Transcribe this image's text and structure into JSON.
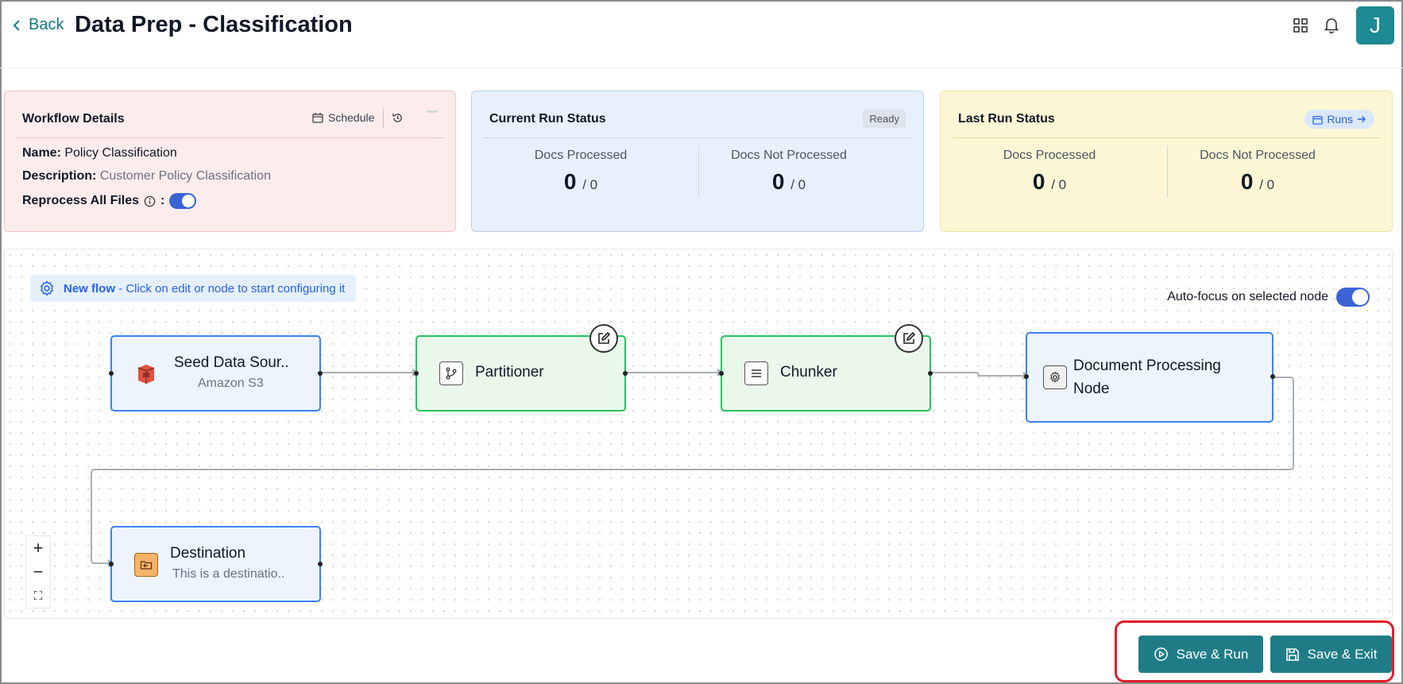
{
  "header": {
    "back_label": "Back",
    "title": "Data Prep - Classification",
    "avatar_initial": "J"
  },
  "workflow_card": {
    "title": "Workflow Details",
    "schedule_label": "Schedule",
    "name_label": "Name:",
    "name_value": "Policy Classification",
    "description_label": "Description:",
    "description_value": "Customer Policy Classification",
    "reprocess_label": "Reprocess All Files",
    "reprocess_colon": ":",
    "reprocess_enabled": true
  },
  "current_run": {
    "title": "Current Run Status",
    "badge": "Ready",
    "processed_label": "Docs Processed",
    "processed_value": "0",
    "processed_total": "/ 0",
    "not_processed_label": "Docs Not Processed",
    "not_processed_value": "0",
    "not_processed_total": "/ 0"
  },
  "last_run": {
    "title": "Last Run Status",
    "runs_label": "Runs",
    "processed_label": "Docs Processed",
    "processed_value": "0",
    "processed_total": "/ 0",
    "not_processed_label": "Docs Not Processed",
    "not_processed_value": "0",
    "not_processed_total": "/ 0"
  },
  "canvas": {
    "new_flow_bold": "New flow",
    "new_flow_text": " - Click on edit or node to start configuring it",
    "autofocus_label": "Auto-focus on selected node",
    "autofocus_enabled": true
  },
  "nodes": {
    "source": {
      "name": "Seed Data Sour..",
      "sub": "Amazon S3"
    },
    "partitioner": {
      "name": "Partitioner"
    },
    "chunker": {
      "name": "Chunker"
    },
    "doc_processing": {
      "name_line1": "Document Processing",
      "name_line2": "Node"
    },
    "destination": {
      "name": "Destination",
      "sub": "This is a destinatio.."
    }
  },
  "zoom_controls": {
    "zoom_in": "+",
    "zoom_out": "−",
    "fit": "⛶"
  },
  "actions": {
    "save_run_label": "Save & Run",
    "save_exit_label": "Save & Exit"
  },
  "colors": {
    "accent": "#1f7c87",
    "highlight_border": "#e11d2a",
    "node_blue_border": "#3b82f6",
    "node_green_border": "#22c55e"
  }
}
